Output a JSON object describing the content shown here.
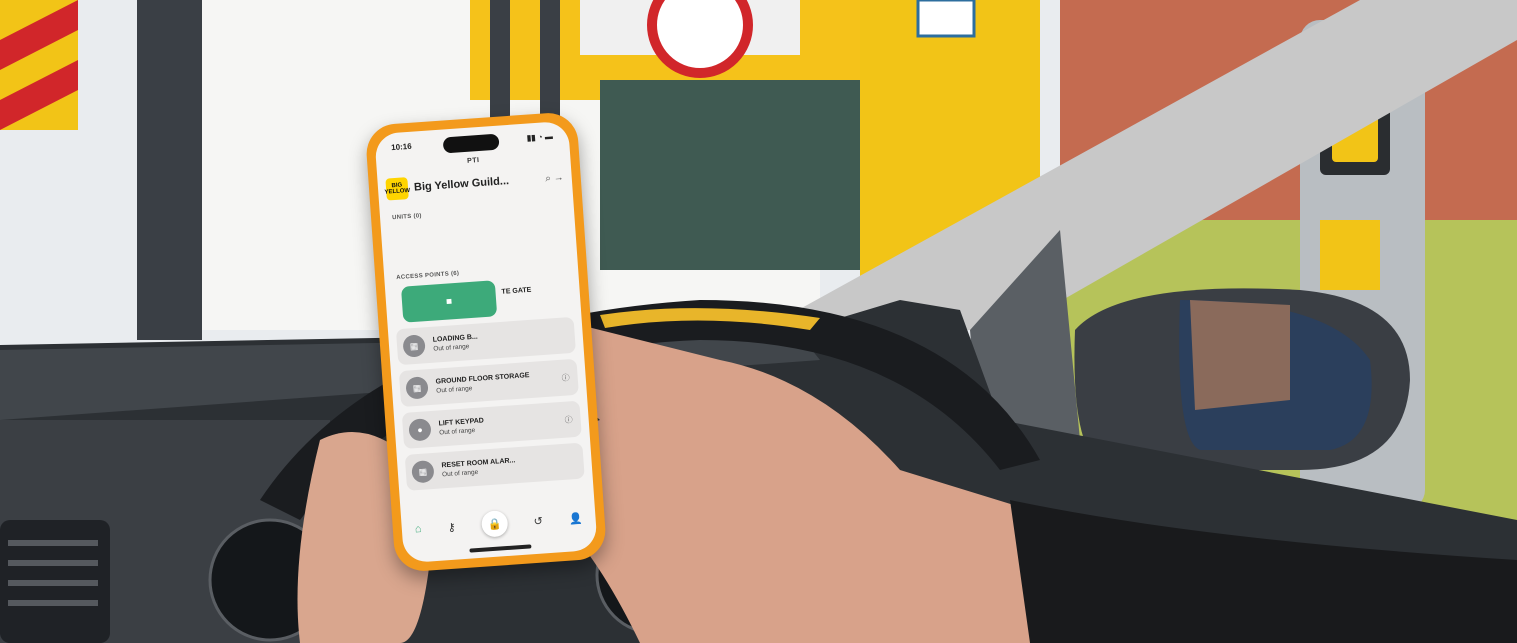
{
  "colors": {
    "brand_yellow": "#ffd400",
    "unlock_green": "#3daa7a",
    "phone_orange": "#f39a1c",
    "icon_grey": "#8a8a8e"
  },
  "status": {
    "time": "10:16",
    "signal": "▮▮ ◔ ▬"
  },
  "brand_label": "PTI",
  "header": {
    "logo_text": "BIG YELLOW",
    "site_name": "Big Yellow Guild...",
    "icons": "⌕ →"
  },
  "sections": {
    "units": "UNITS (0)",
    "access_points": "ACCESS POINTS (6)"
  },
  "access_points": [
    {
      "title": "TE GATE",
      "status": "",
      "icon": "gate-icon",
      "active": true,
      "unlock_icon": "■"
    },
    {
      "title": "LOADING B...",
      "status": "Out of range",
      "icon": "garage-icon"
    },
    {
      "title": "GROUND FLOOR STORAGE",
      "status": "Out of range",
      "icon": "garage-icon"
    },
    {
      "title": "LIFT KEYPAD",
      "status": "Out of range",
      "icon": "keypad-icon"
    },
    {
      "title": "RESET ROOM ALAR...",
      "status": "Out of range",
      "icon": "garage-icon"
    }
  ],
  "tabbar": {
    "home": "⌂",
    "keys": "⚷",
    "lock": "🔒",
    "history": "↺",
    "profile": "👤"
  }
}
